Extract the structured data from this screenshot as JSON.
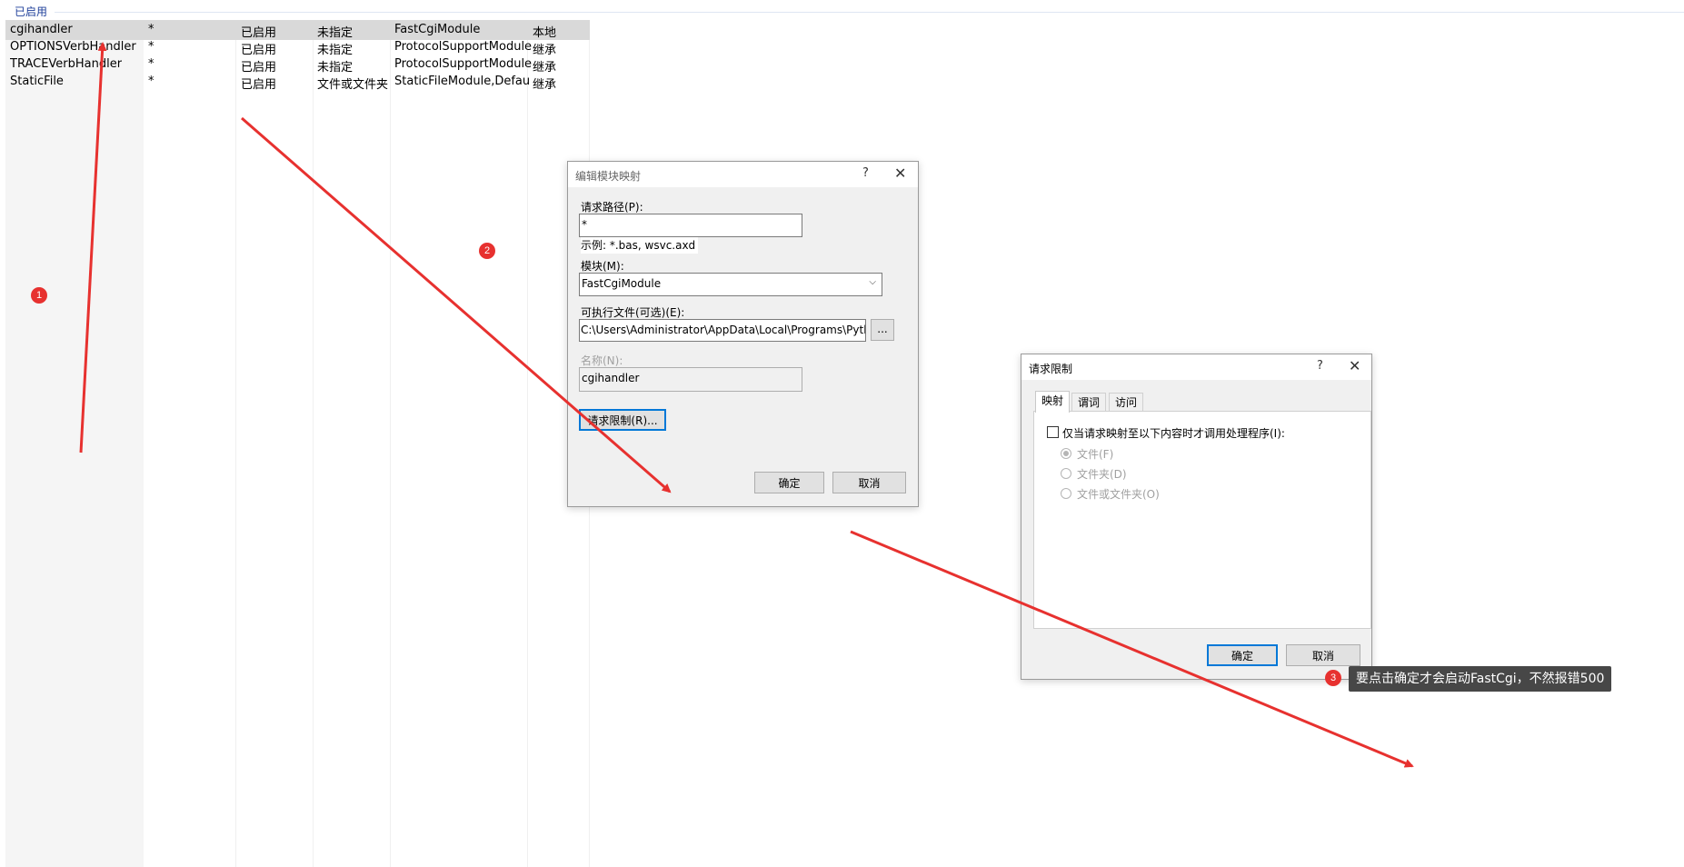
{
  "list": {
    "group_header": "已启用",
    "rows": [
      {
        "name": "cgihandler",
        "path": "*",
        "state": "已启用",
        "path_type": "未指定",
        "handler": "FastCgiModule",
        "entry_type": "本地",
        "selected": true
      },
      {
        "name": "OPTIONSVerbHandler",
        "path": "*",
        "state": "已启用",
        "path_type": "未指定",
        "handler": "ProtocolSupportModule",
        "entry_type": "继承",
        "selected": false
      },
      {
        "name": "TRACEVerbHandler",
        "path": "*",
        "state": "已启用",
        "path_type": "未指定",
        "handler": "ProtocolSupportModule",
        "entry_type": "继承",
        "selected": false
      },
      {
        "name": "StaticFile",
        "path": "*",
        "state": "已启用",
        "path_type": "文件或文件夹",
        "handler": "StaticFileModule,DefaultDo...",
        "entry_type": "继承",
        "selected": false
      }
    ]
  },
  "edit_dialog": {
    "title": "编辑模块映射",
    "help": "?",
    "close": "✕",
    "request_path_label": "请求路径(P):",
    "request_path_value": "*",
    "example_text": "示例: *.bas, wsvc.axd",
    "module_label": "模块(M):",
    "module_value": "FastCgiModule",
    "executable_label": "可执行文件(可选)(E):",
    "executable_value": "C:\\Users\\Administrator\\AppData\\Local\\Programs\\Python\\Pytho",
    "browse_label": "...",
    "name_label": "名称(N):",
    "name_value": "cgihandler",
    "request_restrictions_button": "请求限制(R)...",
    "ok_button": "确定",
    "cancel_button": "取消"
  },
  "restrict_dialog": {
    "title": "请求限制",
    "help": "?",
    "close": "✕",
    "tabs": [
      "映射",
      "谓词",
      "访问"
    ],
    "checkbox_label": "仅当请求映射至以下内容时才调用处理程序(I):",
    "radios": [
      {
        "label": "文件(F)",
        "checked": true
      },
      {
        "label": "文件夹(D)",
        "checked": false
      },
      {
        "label": "文件或文件夹(O)",
        "checked": false
      }
    ],
    "ok_button": "确定",
    "cancel_button": "取消"
  },
  "annotations": {
    "badges": [
      "1",
      "2",
      "3"
    ],
    "note": "要点击确定才会启动FastCgi，不然报错500",
    "color": "#e7312f"
  }
}
